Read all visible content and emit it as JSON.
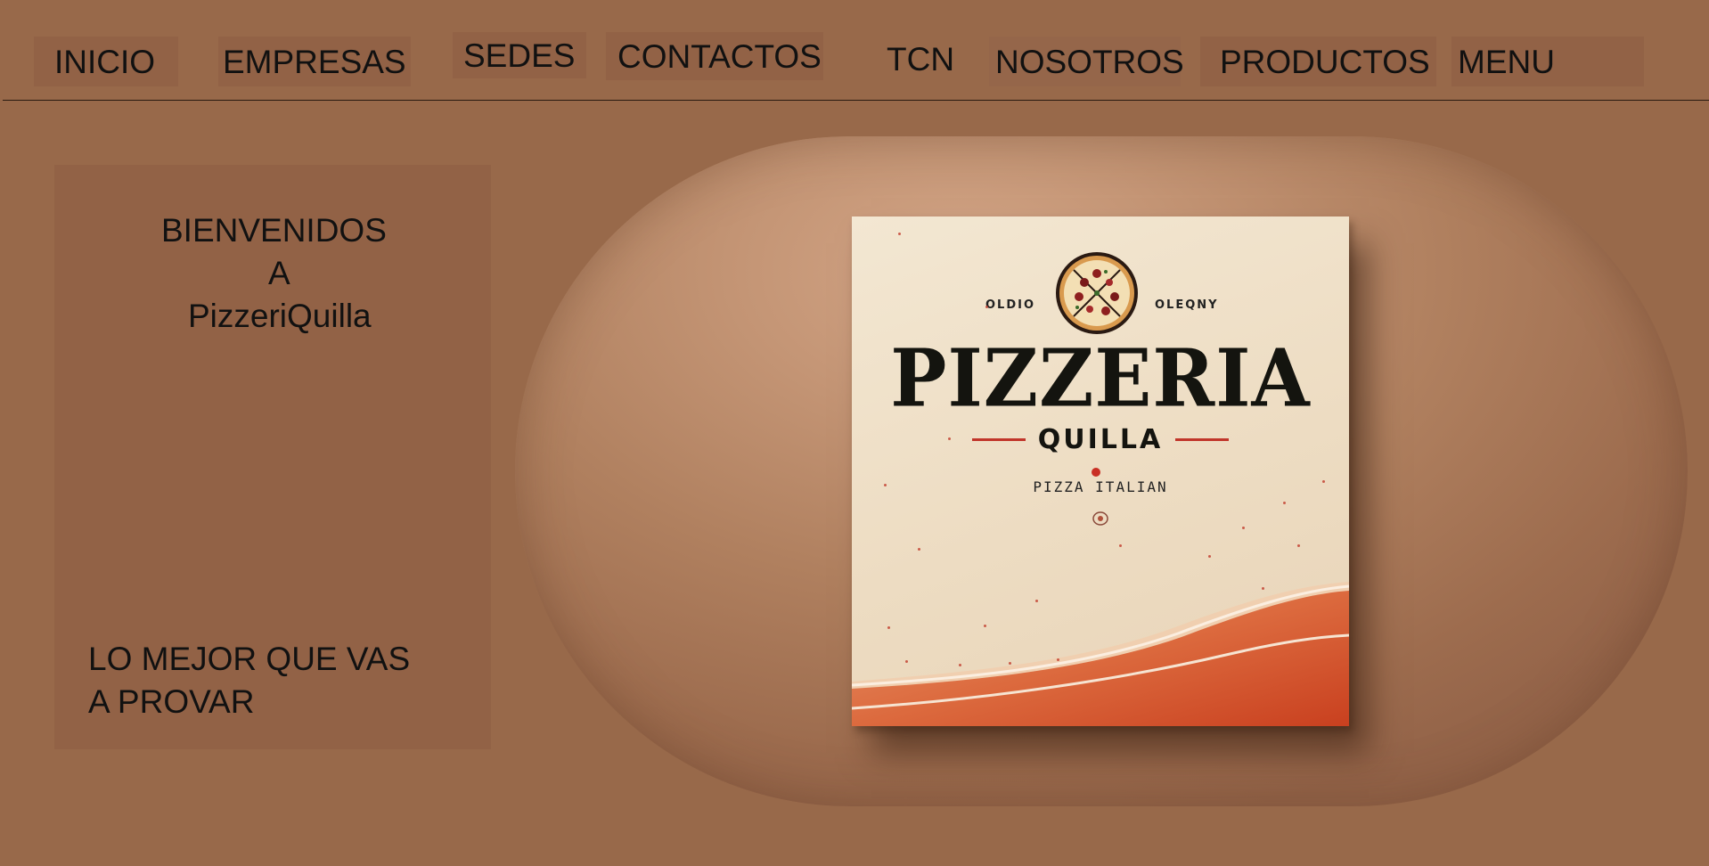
{
  "nav": {
    "items": [
      {
        "label": "INICIO"
      },
      {
        "label": "EMPRESAS"
      },
      {
        "label": "SEDES"
      },
      {
        "label": "CONTACTOS"
      },
      {
        "label": "TCN"
      },
      {
        "label": "NOSOTROS"
      },
      {
        "label": "PRODUCTOS"
      },
      {
        "label": "MENU"
      }
    ]
  },
  "welcome": {
    "lines": [
      "BIENVENIDOS",
      "A",
      "PizzeriQuilla"
    ],
    "tagline": [
      "LO MEJOR QUE VAS",
      "A PROVAR"
    ]
  },
  "hero": {
    "box": {
      "small_left": "OLDIO",
      "small_right": "OLEQNY",
      "name": "PIZZERIA",
      "sub": "QUILLA",
      "tagline": "PIZZA ITALIAN",
      "emblem_icon": "pizza-icon"
    }
  },
  "colors": {
    "background": "#98694a",
    "panel": "#926246",
    "hero_light": "#d3a586",
    "box_cream": "#f3e7d2",
    "box_wave": "#d9542c",
    "accent_red": "#c1352a",
    "text": "#111111"
  }
}
